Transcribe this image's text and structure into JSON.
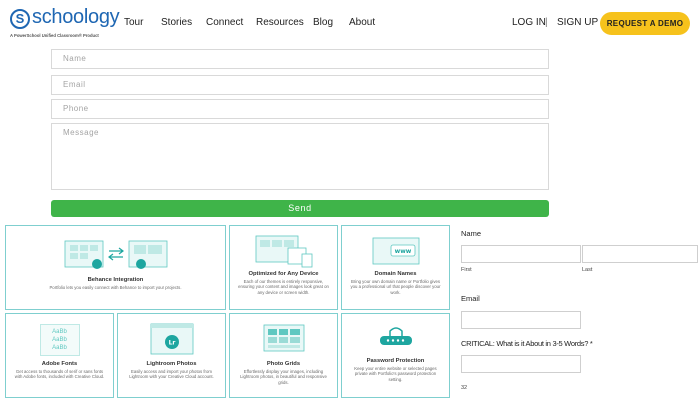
{
  "header": {
    "logo_mark": "S",
    "logo_text": "schoology",
    "logo_tagline": "A PowerSchool Unified Classroom® Product",
    "nav_links": [
      "Tour",
      "Stories",
      "Connect",
      "Resources",
      "Blog",
      "About"
    ],
    "login": "LOG IN",
    "divider": "|",
    "signup": "SIGN UP",
    "cta": "REQUEST A DEMO"
  },
  "contact_form": {
    "name_placeholder": "Name",
    "email_placeholder": "Email",
    "phone_placeholder": "Phone",
    "message_placeholder": "Message",
    "submit_label": "Send"
  },
  "features": [
    {
      "title": "Behance Integration",
      "desc": "Portfolio lets you easily connect with Behance to import your projects.",
      "icon": "behance-sync-icon"
    },
    {
      "title": "Optimized for Any Device",
      "desc": "Each of our themes is entirely responsive, ensuring your content and images look great on any device or screen width.",
      "icon": "devices-icon"
    },
    {
      "title": "Domain Names",
      "desc": "Bring your own domain name or Portfolio gives you a professional url that people discover your work.",
      "icon": "www-icon"
    },
    {
      "title": "Adobe Fonts",
      "desc": "Get access to thousands of serif or sans fonts with Adobe fonts, included with Creative Cloud.",
      "icon": "fonts-icon",
      "sample": [
        "AaBb",
        "AaBb",
        "AaBb"
      ]
    },
    {
      "title": "Lightroom Photos",
      "desc": "Easily access and import your photos from Lightroom with your Creative Cloud account.",
      "icon": "lightroom-icon",
      "badge": "Lr"
    },
    {
      "title": "Photo Grids",
      "desc": "Effortlessly display your images, including Lightroom photos, in beautiful and responsive grids.",
      "icon": "grid-icon"
    },
    {
      "title": "Password Protection",
      "desc": "Keep your entire website or selected pages private with Portfolio's password protection setting.",
      "icon": "lock-icon"
    }
  ],
  "side_form": {
    "name_label": "Name",
    "first_label": "First",
    "last_label": "Last",
    "email_label": "Email",
    "question_label": "CRITICAL: What is it About in 3-5 Words? *",
    "counter": "32"
  },
  "colors": {
    "brand": "#1f67b3",
    "cta": "#f6c21c",
    "send": "#3fb449",
    "card_border": "#7fcfcf",
    "accent": "#5fc8c1"
  }
}
